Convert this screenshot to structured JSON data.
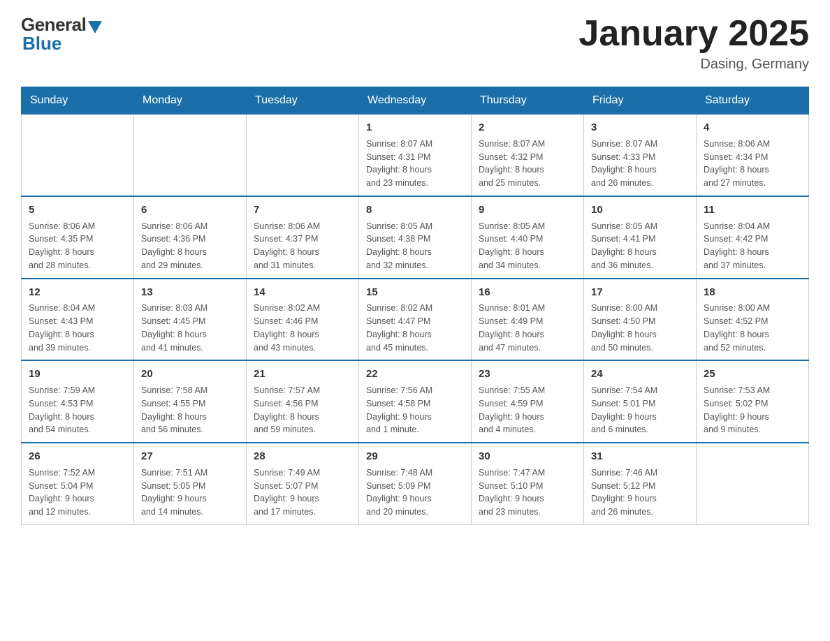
{
  "logo": {
    "general": "General",
    "blue": "Blue"
  },
  "title": "January 2025",
  "location": "Dasing, Germany",
  "days_of_week": [
    "Sunday",
    "Monday",
    "Tuesday",
    "Wednesday",
    "Thursday",
    "Friday",
    "Saturday"
  ],
  "weeks": [
    [
      {
        "day": "",
        "info": ""
      },
      {
        "day": "",
        "info": ""
      },
      {
        "day": "",
        "info": ""
      },
      {
        "day": "1",
        "info": "Sunrise: 8:07 AM\nSunset: 4:31 PM\nDaylight: 8 hours\nand 23 minutes."
      },
      {
        "day": "2",
        "info": "Sunrise: 8:07 AM\nSunset: 4:32 PM\nDaylight: 8 hours\nand 25 minutes."
      },
      {
        "day": "3",
        "info": "Sunrise: 8:07 AM\nSunset: 4:33 PM\nDaylight: 8 hours\nand 26 minutes."
      },
      {
        "day": "4",
        "info": "Sunrise: 8:06 AM\nSunset: 4:34 PM\nDaylight: 8 hours\nand 27 minutes."
      }
    ],
    [
      {
        "day": "5",
        "info": "Sunrise: 8:06 AM\nSunset: 4:35 PM\nDaylight: 8 hours\nand 28 minutes."
      },
      {
        "day": "6",
        "info": "Sunrise: 8:06 AM\nSunset: 4:36 PM\nDaylight: 8 hours\nand 29 minutes."
      },
      {
        "day": "7",
        "info": "Sunrise: 8:06 AM\nSunset: 4:37 PM\nDaylight: 8 hours\nand 31 minutes."
      },
      {
        "day": "8",
        "info": "Sunrise: 8:05 AM\nSunset: 4:38 PM\nDaylight: 8 hours\nand 32 minutes."
      },
      {
        "day": "9",
        "info": "Sunrise: 8:05 AM\nSunset: 4:40 PM\nDaylight: 8 hours\nand 34 minutes."
      },
      {
        "day": "10",
        "info": "Sunrise: 8:05 AM\nSunset: 4:41 PM\nDaylight: 8 hours\nand 36 minutes."
      },
      {
        "day": "11",
        "info": "Sunrise: 8:04 AM\nSunset: 4:42 PM\nDaylight: 8 hours\nand 37 minutes."
      }
    ],
    [
      {
        "day": "12",
        "info": "Sunrise: 8:04 AM\nSunset: 4:43 PM\nDaylight: 8 hours\nand 39 minutes."
      },
      {
        "day": "13",
        "info": "Sunrise: 8:03 AM\nSunset: 4:45 PM\nDaylight: 8 hours\nand 41 minutes."
      },
      {
        "day": "14",
        "info": "Sunrise: 8:02 AM\nSunset: 4:46 PM\nDaylight: 8 hours\nand 43 minutes."
      },
      {
        "day": "15",
        "info": "Sunrise: 8:02 AM\nSunset: 4:47 PM\nDaylight: 8 hours\nand 45 minutes."
      },
      {
        "day": "16",
        "info": "Sunrise: 8:01 AM\nSunset: 4:49 PM\nDaylight: 8 hours\nand 47 minutes."
      },
      {
        "day": "17",
        "info": "Sunrise: 8:00 AM\nSunset: 4:50 PM\nDaylight: 8 hours\nand 50 minutes."
      },
      {
        "day": "18",
        "info": "Sunrise: 8:00 AM\nSunset: 4:52 PM\nDaylight: 8 hours\nand 52 minutes."
      }
    ],
    [
      {
        "day": "19",
        "info": "Sunrise: 7:59 AM\nSunset: 4:53 PM\nDaylight: 8 hours\nand 54 minutes."
      },
      {
        "day": "20",
        "info": "Sunrise: 7:58 AM\nSunset: 4:55 PM\nDaylight: 8 hours\nand 56 minutes."
      },
      {
        "day": "21",
        "info": "Sunrise: 7:57 AM\nSunset: 4:56 PM\nDaylight: 8 hours\nand 59 minutes."
      },
      {
        "day": "22",
        "info": "Sunrise: 7:56 AM\nSunset: 4:58 PM\nDaylight: 9 hours\nand 1 minute."
      },
      {
        "day": "23",
        "info": "Sunrise: 7:55 AM\nSunset: 4:59 PM\nDaylight: 9 hours\nand 4 minutes."
      },
      {
        "day": "24",
        "info": "Sunrise: 7:54 AM\nSunset: 5:01 PM\nDaylight: 9 hours\nand 6 minutes."
      },
      {
        "day": "25",
        "info": "Sunrise: 7:53 AM\nSunset: 5:02 PM\nDaylight: 9 hours\nand 9 minutes."
      }
    ],
    [
      {
        "day": "26",
        "info": "Sunrise: 7:52 AM\nSunset: 5:04 PM\nDaylight: 9 hours\nand 12 minutes."
      },
      {
        "day": "27",
        "info": "Sunrise: 7:51 AM\nSunset: 5:05 PM\nDaylight: 9 hours\nand 14 minutes."
      },
      {
        "day": "28",
        "info": "Sunrise: 7:49 AM\nSunset: 5:07 PM\nDaylight: 9 hours\nand 17 minutes."
      },
      {
        "day": "29",
        "info": "Sunrise: 7:48 AM\nSunset: 5:09 PM\nDaylight: 9 hours\nand 20 minutes."
      },
      {
        "day": "30",
        "info": "Sunrise: 7:47 AM\nSunset: 5:10 PM\nDaylight: 9 hours\nand 23 minutes."
      },
      {
        "day": "31",
        "info": "Sunrise: 7:46 AM\nSunset: 5:12 PM\nDaylight: 9 hours\nand 26 minutes."
      },
      {
        "day": "",
        "info": ""
      }
    ]
  ]
}
